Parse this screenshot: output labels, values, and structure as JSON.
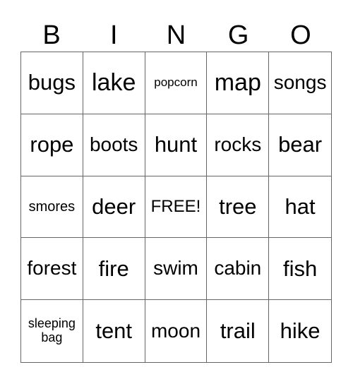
{
  "header": [
    "B",
    "I",
    "N",
    "G",
    "O"
  ],
  "cells": [
    {
      "text": "bugs",
      "size": "s-l"
    },
    {
      "text": "lake",
      "size": "s-xl"
    },
    {
      "text": "popcorn",
      "size": "s-tiny"
    },
    {
      "text": "map",
      "size": "s-xl"
    },
    {
      "text": "songs",
      "size": "s-m"
    },
    {
      "text": "rope",
      "size": "s-l"
    },
    {
      "text": "boots",
      "size": "s-m"
    },
    {
      "text": "hunt",
      "size": "s-l"
    },
    {
      "text": "rocks",
      "size": "s-m"
    },
    {
      "text": "bear",
      "size": "s-l"
    },
    {
      "text": "smores",
      "size": "s-xs"
    },
    {
      "text": "deer",
      "size": "s-l"
    },
    {
      "text": "FREE!",
      "size": "s-s"
    },
    {
      "text": "tree",
      "size": "s-l"
    },
    {
      "text": "hat",
      "size": "s-l"
    },
    {
      "text": "forest",
      "size": "s-m"
    },
    {
      "text": "fire",
      "size": "s-l"
    },
    {
      "text": "swim",
      "size": "s-m"
    },
    {
      "text": "cabin",
      "size": "s-m"
    },
    {
      "text": "fish",
      "size": "s-l"
    },
    {
      "text": "sleeping bag",
      "size": "s-xxs"
    },
    {
      "text": "tent",
      "size": "s-l"
    },
    {
      "text": "moon",
      "size": "s-m"
    },
    {
      "text": "trail",
      "size": "s-l"
    },
    {
      "text": "hike",
      "size": "s-l"
    }
  ]
}
